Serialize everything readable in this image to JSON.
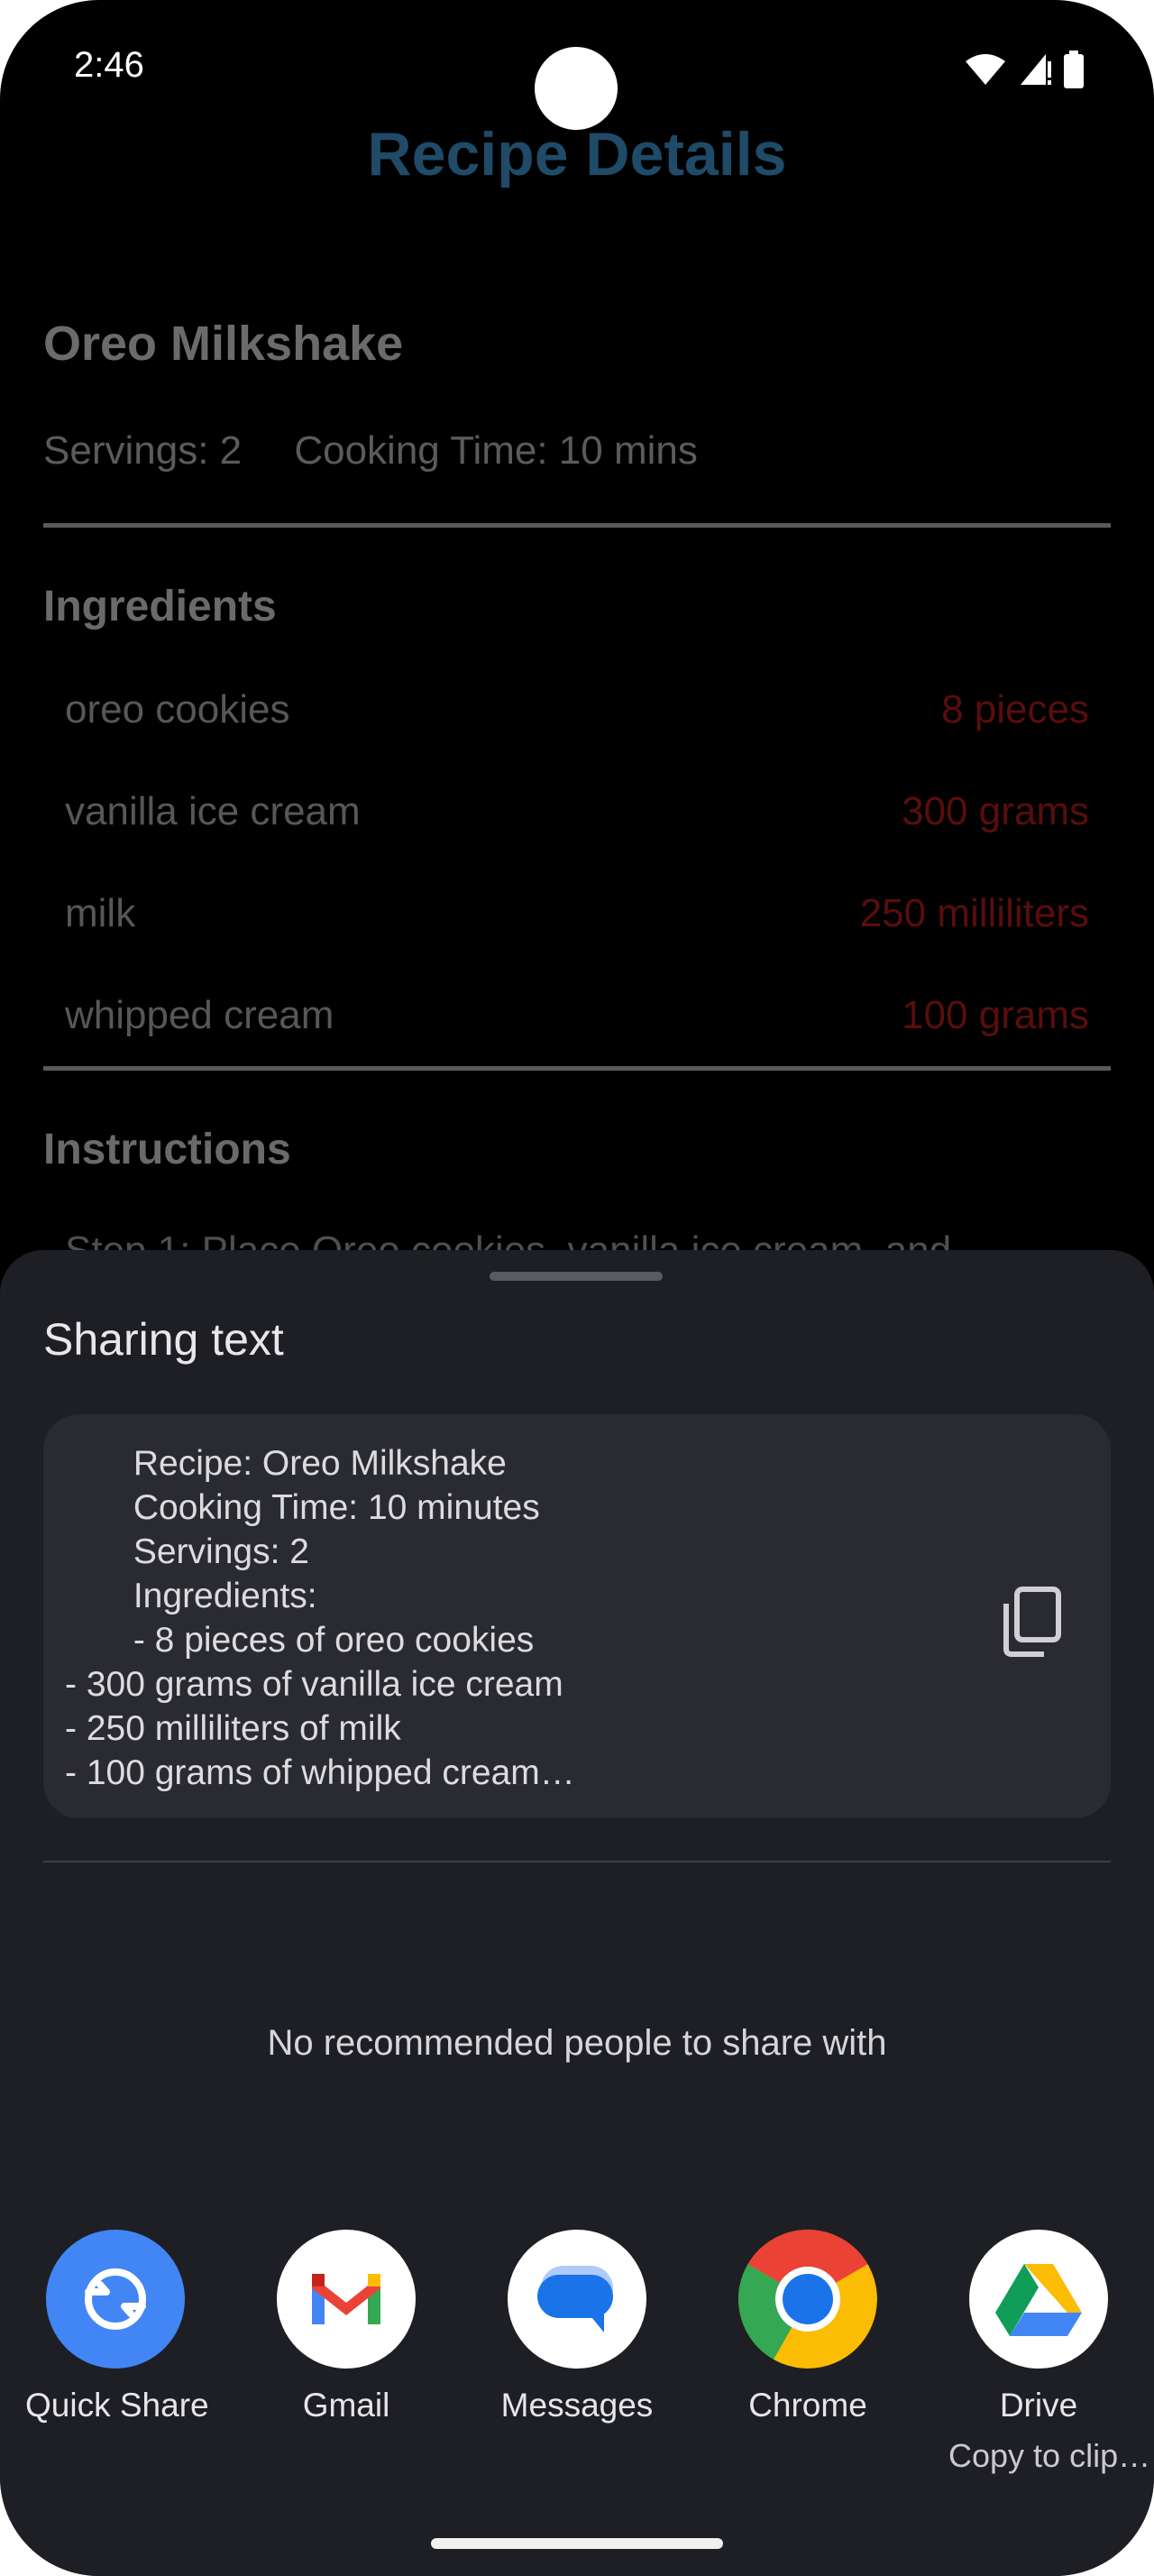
{
  "status_bar": {
    "time": "2:46"
  },
  "page": {
    "title": "Recipe Details"
  },
  "recipe": {
    "name": "Oreo Milkshake",
    "servings": "Servings: 2",
    "cooking_time": "Cooking Time: 10 mins",
    "ingredients_title": "Ingredients",
    "ingredients": [
      {
        "name": "oreo cookies",
        "qty": "8 pieces"
      },
      {
        "name": "vanilla ice cream",
        "qty": "300 grams"
      },
      {
        "name": "milk",
        "qty": "250 milliliters"
      },
      {
        "name": "whipped cream",
        "qty": "100 grams"
      }
    ],
    "instructions_title": "Instructions",
    "instructions_peek": "Step 1: Place Oreo cookies, vanilla ice cream, and"
  },
  "share_sheet": {
    "title": "Sharing text",
    "preview_text": "       Recipe: Oreo Milkshake\n       Cooking Time: 10 minutes\n       Servings: 2\n       Ingredients:\n       - 8 pieces of oreo cookies\n- 300 grams of vanilla ice cream\n- 250 milliliters of milk\n- 100 grams of whipped cream…",
    "no_people": "No recommended people to share with",
    "targets": [
      {
        "label": "Quick Share",
        "icon": "quick-share-icon"
      },
      {
        "label": "Gmail",
        "icon": "gmail-icon"
      },
      {
        "label": "Messages",
        "icon": "messages-icon"
      },
      {
        "label": "Chrome",
        "icon": "chrome-icon"
      },
      {
        "label": "Drive",
        "sublabel": "Copy to clip…",
        "icon": "drive-icon"
      }
    ]
  },
  "colors": {
    "title": "#1f4a68",
    "sheet_bg": "#1e1f25",
    "quick_share": "#4285f4",
    "qty": "#5a0d0d"
  }
}
